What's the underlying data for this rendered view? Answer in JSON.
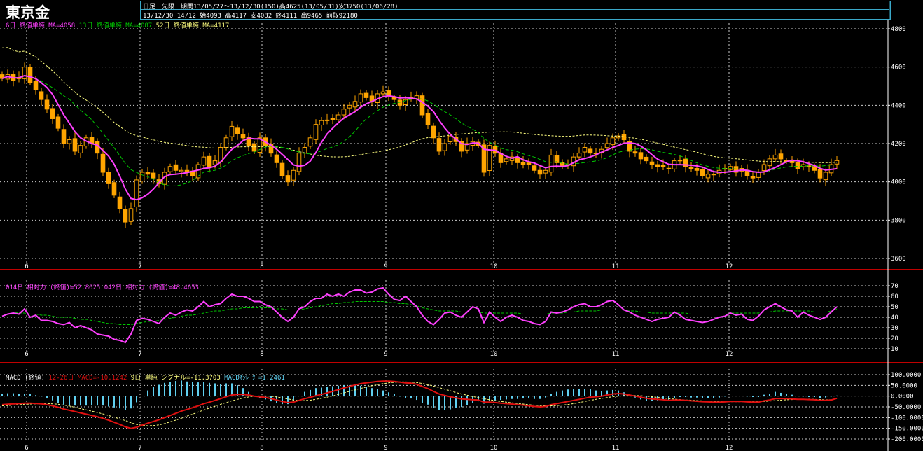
{
  "header": {
    "title": "東京金",
    "line1": "日足　先限　期間13/05/27～13/12/30(150)高4625(13/05/31)安3750(13/06/28)",
    "line2": "13/12/30 14/12 始4093 高4117 安4082 終4111 出9465 前取92180"
  },
  "price_legend": {
    "ma6": "6日 終値単純 MA=4058",
    "ma13": "13日 終値単純 MA=4087",
    "ma52": "52日 終値単純 MA=4117"
  },
  "rsi_legend": {
    "r14": "014日 相対力 (終値)=52.8625",
    "r42": "042日 相対力 (終値)=48.4653"
  },
  "macd_legend": {
    "name": "MACD (終値)",
    "macd": "12-26日 MACD=-10.1242",
    "signal": "9日 単純 シグナル=-11.3703",
    "osc": "MACDｵｼﾚｰﾀｰ=1.2461"
  },
  "colors": {
    "up": "#ffa500",
    "down": "#ffa500",
    "ma6": "#ff40ff",
    "ma13": "#00c800",
    "ma52": "#ffff80",
    "rsi14": "#ff40ff",
    "rsi42": "#00c800",
    "macd": "#e01010",
    "signal": "#ffff80",
    "osc": "#60d0f0",
    "grid": "#ffffff",
    "panel_border": "#c00000"
  },
  "x_ticks": [
    "6",
    "7",
    "8",
    "9",
    "10",
    "11",
    "12"
  ],
  "chart_data": [
    {
      "type": "candlestick",
      "title": "東京金",
      "ylim": [
        3600,
        4800
      ],
      "y_ticks": [
        3600,
        3800,
        4000,
        4200,
        4400,
        4600,
        4800
      ],
      "x_ticks": [
        "6",
        "7",
        "8",
        "9",
        "10",
        "11",
        "12"
      ],
      "closes": [
        4540,
        4560,
        4530,
        4545,
        4600,
        4520,
        4480,
        4430,
        4380,
        4330,
        4280,
        4200,
        4220,
        4160,
        4190,
        4230,
        4200,
        4150,
        4050,
        3990,
        3930,
        3860,
        3790,
        3860,
        4010,
        4050,
        4040,
        4020,
        3990,
        4050,
        4080,
        4060,
        4060,
        4050,
        4030,
        4090,
        4130,
        4080,
        4110,
        4180,
        4230,
        4290,
        4250,
        4230,
        4190,
        4160,
        4230,
        4190,
        4150,
        4100,
        4030,
        4000,
        4060,
        4150,
        4180,
        4230,
        4300,
        4320,
        4320,
        4330,
        4350,
        4380,
        4400,
        4420,
        4460,
        4440,
        4420,
        4460,
        4470,
        4450,
        4430,
        4400,
        4430,
        4440,
        4450,
        4350,
        4300,
        4230,
        4160,
        4200,
        4240,
        4210,
        4160,
        4200,
        4210,
        4190,
        4050,
        4190,
        4150,
        4100,
        4120,
        4130,
        4100,
        4090,
        4090,
        4060,
        4040,
        4060,
        4140,
        4100,
        4080,
        4090,
        4130,
        4150,
        4180,
        4150,
        4150,
        4170,
        4200,
        4230,
        4240,
        4220,
        4160,
        4150,
        4120,
        4110,
        4090,
        4080,
        4080,
        4070,
        4110,
        4110,
        4080,
        4070,
        4060,
        4030,
        4040,
        4040,
        4060,
        4070,
        4080,
        4050,
        4070,
        4030,
        4020,
        4050,
        4090,
        4120,
        4140,
        4120,
        4110,
        4100,
        4070,
        4090,
        4080,
        4060,
        4020,
        4050,
        4090,
        4111
      ],
      "series": [
        {
          "name": "6日 終値単純",
          "values": "ma6 of closes"
        },
        {
          "name": "13日 終値単純",
          "values": "ma13 of closes"
        },
        {
          "name": "52日 終値単純",
          "values": "ma52 of closes"
        }
      ]
    },
    {
      "type": "line",
      "ylim": [
        10,
        70
      ],
      "y_ticks": [
        10,
        20,
        30,
        40,
        50,
        60,
        70
      ],
      "series": [
        {
          "name": "014日 相対力 (終値)",
          "values": [
            41,
            43,
            44,
            43,
            48,
            40,
            42,
            37,
            37,
            36,
            34,
            33,
            35,
            30,
            32,
            30,
            28,
            24,
            23,
            22,
            19,
            18,
            16,
            24,
            37,
            39,
            38,
            36,
            34,
            40,
            44,
            42,
            45,
            47,
            46,
            50,
            55,
            50,
            52,
            53,
            58,
            62,
            60,
            60,
            58,
            55,
            55,
            52,
            50,
            45,
            40,
            36,
            40,
            48,
            50,
            55,
            58,
            58,
            62,
            60,
            62,
            60,
            64,
            66,
            66,
            63,
            64,
            67,
            68,
            62,
            57,
            56,
            60,
            55,
            50,
            42,
            36,
            33,
            38,
            44,
            45,
            42,
            40,
            45,
            50,
            48,
            35,
            45,
            40,
            36,
            40,
            42,
            40,
            37,
            36,
            34,
            33,
            36,
            45,
            44,
            45,
            47,
            50,
            52,
            53,
            50,
            50,
            52,
            55,
            56,
            52,
            47,
            45,
            42,
            40,
            38,
            36,
            38,
            39,
            40,
            45,
            42,
            38,
            37,
            36,
            35,
            36,
            38,
            40,
            41,
            44,
            42,
            43,
            38,
            37,
            41,
            47,
            50,
            53,
            50,
            47,
            46,
            40,
            45,
            42,
            40,
            38,
            40,
            45,
            50
          ]
        },
        {
          "name": "042日 相対力 (終値)",
          "values": [
            45,
            45,
            45,
            44,
            44,
            43,
            43,
            42,
            42,
            41,
            40,
            40,
            40,
            39,
            38,
            38,
            37,
            36,
            35,
            34,
            34,
            33,
            33,
            33,
            34,
            35,
            36,
            36,
            37,
            38,
            39,
            40,
            41,
            42,
            42,
            43,
            44,
            45,
            46,
            46,
            47,
            48,
            48,
            49,
            49,
            49,
            49,
            49,
            49,
            48,
            48,
            47,
            47,
            47,
            48,
            49,
            50,
            51,
            52,
            53,
            53,
            54,
            54,
            55,
            55,
            55,
            55,
            55,
            55,
            54,
            54,
            53,
            53,
            52,
            51,
            49,
            48,
            47,
            46,
            46,
            46,
            46,
            45,
            45,
            45,
            45,
            44,
            44,
            44,
            44,
            44,
            44,
            44,
            43,
            43,
            43,
            43,
            43,
            44,
            44,
            44,
            45,
            45,
            46,
            46,
            46,
            46,
            47,
            47,
            47,
            47,
            47,
            46,
            46,
            45,
            45,
            44,
            44,
            44,
            44,
            44,
            44,
            44,
            43,
            43,
            43,
            43,
            43,
            43,
            43,
            44,
            44,
            44,
            44,
            44,
            44,
            45,
            45,
            46,
            46,
            46,
            46,
            46,
            46,
            46,
            45,
            45,
            45,
            46,
            48
          ]
        }
      ]
    },
    {
      "type": "line",
      "ylim": [
        -200000,
        100000
      ],
      "y_ticks": [
        100000,
        50000,
        0,
        -50000,
        -100000,
        -150000,
        -200000
      ],
      "y_tick_labels": [
        "100.0000",
        "50.0000",
        "0.0000",
        "-50.0000",
        "-100.0000",
        "-150.0000",
        "-200.0000"
      ],
      "series": [
        {
          "name": "12-26日 MACD",
          "values": [
            -40000,
            -38000,
            -36000,
            -35000,
            -33000,
            -33000,
            -34000,
            -36000,
            -40000,
            -45000,
            -52000,
            -60000,
            -66000,
            -72000,
            -78000,
            -84000,
            -90000,
            -96000,
            -103000,
            -112000,
            -122000,
            -132000,
            -143000,
            -150000,
            -145000,
            -135000,
            -126000,
            -118000,
            -110000,
            -100000,
            -90000,
            -80000,
            -70000,
            -62000,
            -54000,
            -45000,
            -35000,
            -28000,
            -20000,
            -12000,
            -3000,
            5000,
            8000,
            8000,
            5000,
            0,
            -3000,
            -6000,
            -12000,
            -18000,
            -25000,
            -30000,
            -28000,
            -20000,
            -12000,
            -6000,
            2000,
            8000,
            15000,
            22000,
            30000,
            38000,
            45000,
            52000,
            58000,
            62000,
            65000,
            68000,
            70000,
            70000,
            68000,
            65000,
            62000,
            60000,
            55000,
            45000,
            35000,
            22000,
            10000,
            3000,
            -3000,
            -8000,
            -13000,
            -15000,
            -17000,
            -18000,
            -28000,
            -28000,
            -30000,
            -33000,
            -35000,
            -37000,
            -40000,
            -42000,
            -45000,
            -48000,
            -50000,
            -48000,
            -40000,
            -35000,
            -30000,
            -25000,
            -20000,
            -15000,
            -10000,
            -5000,
            -3000,
            0,
            5000,
            10000,
            12000,
            10000,
            5000,
            0,
            -5000,
            -10000,
            -13000,
            -15000,
            -17000,
            -20000,
            -18000,
            -18000,
            -20000,
            -22000,
            -24000,
            -26000,
            -27000,
            -28000,
            -28000,
            -27000,
            -25000,
            -25000,
            -25000,
            -27000,
            -28000,
            -28000,
            -22000,
            -18000,
            -12000,
            -12000,
            -12000,
            -13000,
            -15000,
            -15000,
            -16000,
            -17000,
            -20000,
            -20000,
            -18000,
            -10124
          ]
        },
        {
          "name": "9日 単純 シグナル",
          "values": [
            -45000,
            -44000,
            -42000,
            -40000,
            -38000,
            -37000,
            -36000,
            -35000,
            -35000,
            -36000,
            -38000,
            -42000,
            -46000,
            -52000,
            -58000,
            -64000,
            -70000,
            -76000,
            -83000,
            -90000,
            -98000,
            -106000,
            -114000,
            -124000,
            -132000,
            -136000,
            -138000,
            -137000,
            -134000,
            -128000,
            -120000,
            -112000,
            -103000,
            -93000,
            -84000,
            -74000,
            -65000,
            -56000,
            -47000,
            -38000,
            -30000,
            -22000,
            -15000,
            -9000,
            -4000,
            0,
            1000,
            1000,
            -1000,
            -4000,
            -8000,
            -13000,
            -18000,
            -21000,
            -21000,
            -19000,
            -15000,
            -10000,
            -5000,
            1000,
            8000,
            15000,
            22000,
            29000,
            36000,
            42000,
            48000,
            53000,
            58000,
            62000,
            64000,
            66000,
            66000,
            65000,
            63000,
            59000,
            53000,
            47000,
            40000,
            32000,
            25000,
            17000,
            10000,
            4000,
            -2000,
            -7000,
            -12000,
            -17000,
            -21000,
            -25000,
            -28000,
            -31000,
            -34000,
            -37000,
            -40000,
            -42000,
            -44000,
            -45000,
            -45000,
            -44000,
            -42000,
            -39000,
            -35000,
            -30000,
            -25000,
            -20000,
            -15000,
            -11000,
            -7000,
            -3000,
            0,
            2000,
            3000,
            3000,
            2000,
            0,
            -3000,
            -6000,
            -9000,
            -12000,
            -14000,
            -16000,
            -18000,
            -19000,
            -21000,
            -22000,
            -23000,
            -24000,
            -25000,
            -26000,
            -26000,
            -26000,
            -26000,
            -26000,
            -26000,
            -26000,
            -25000,
            -23000,
            -21000,
            -19000,
            -17000,
            -16000,
            -15000,
            -14000,
            -14000,
            -15000,
            -16000,
            -17000,
            -17000,
            -11370
          ]
        }
      ]
    }
  ]
}
